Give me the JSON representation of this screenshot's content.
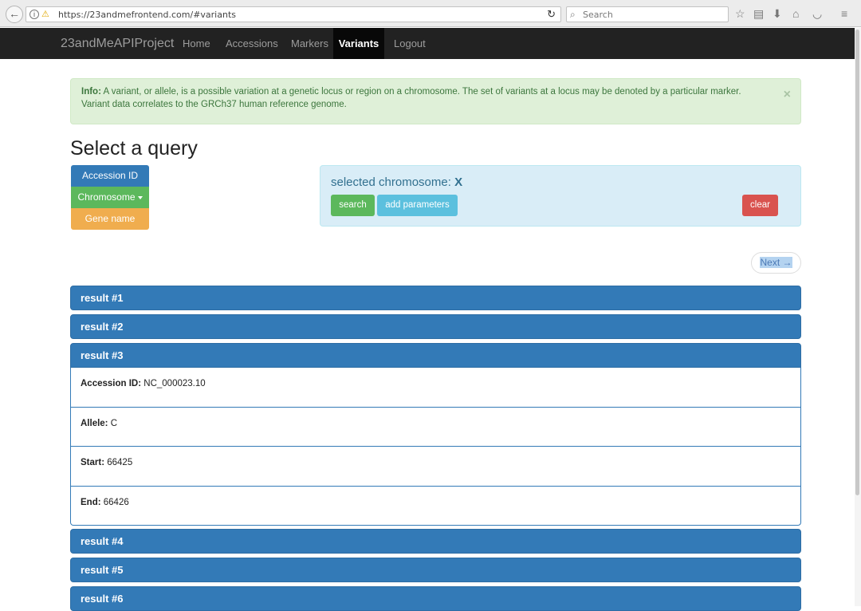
{
  "browser": {
    "url": "https://23andmefrontend.com/#variants",
    "search_placeholder": "Search"
  },
  "navbar": {
    "brand": "23andMeAPIProject",
    "items": [
      "Home",
      "Accessions",
      "Markers",
      "Variants",
      "Logout"
    ],
    "active": "Variants"
  },
  "alert": {
    "label": "Info:",
    "text": "A variant, or allele, is a possible variation at a genetic locus or region on a chromosome. The set of variants at a locus may be denoted by a particular marker. Variant data correlates to the GRCh37 human reference genome.",
    "close": "×"
  },
  "page_title": "Select a query",
  "query_buttons": {
    "accession": "Accession ID",
    "chromosome": "Chromosome",
    "gene": "Gene name"
  },
  "selection": {
    "label": "selected chromosome:",
    "value": "X",
    "search_btn": "search",
    "add_btn": "add parameters",
    "clear_btn": "clear"
  },
  "pager": {
    "next": "Next →"
  },
  "results": [
    {
      "title": "result #1"
    },
    {
      "title": "result #2"
    },
    {
      "title": "result #3",
      "fields": [
        {
          "label": "Accession ID:",
          "value": "NC_000023.10"
        },
        {
          "label": "Allele:",
          "value": "C"
        },
        {
          "label": "Start:",
          "value": "66425"
        },
        {
          "label": "End:",
          "value": "66426"
        }
      ]
    },
    {
      "title": "result #4"
    },
    {
      "title": "result #5"
    },
    {
      "title": "result #6"
    }
  ]
}
